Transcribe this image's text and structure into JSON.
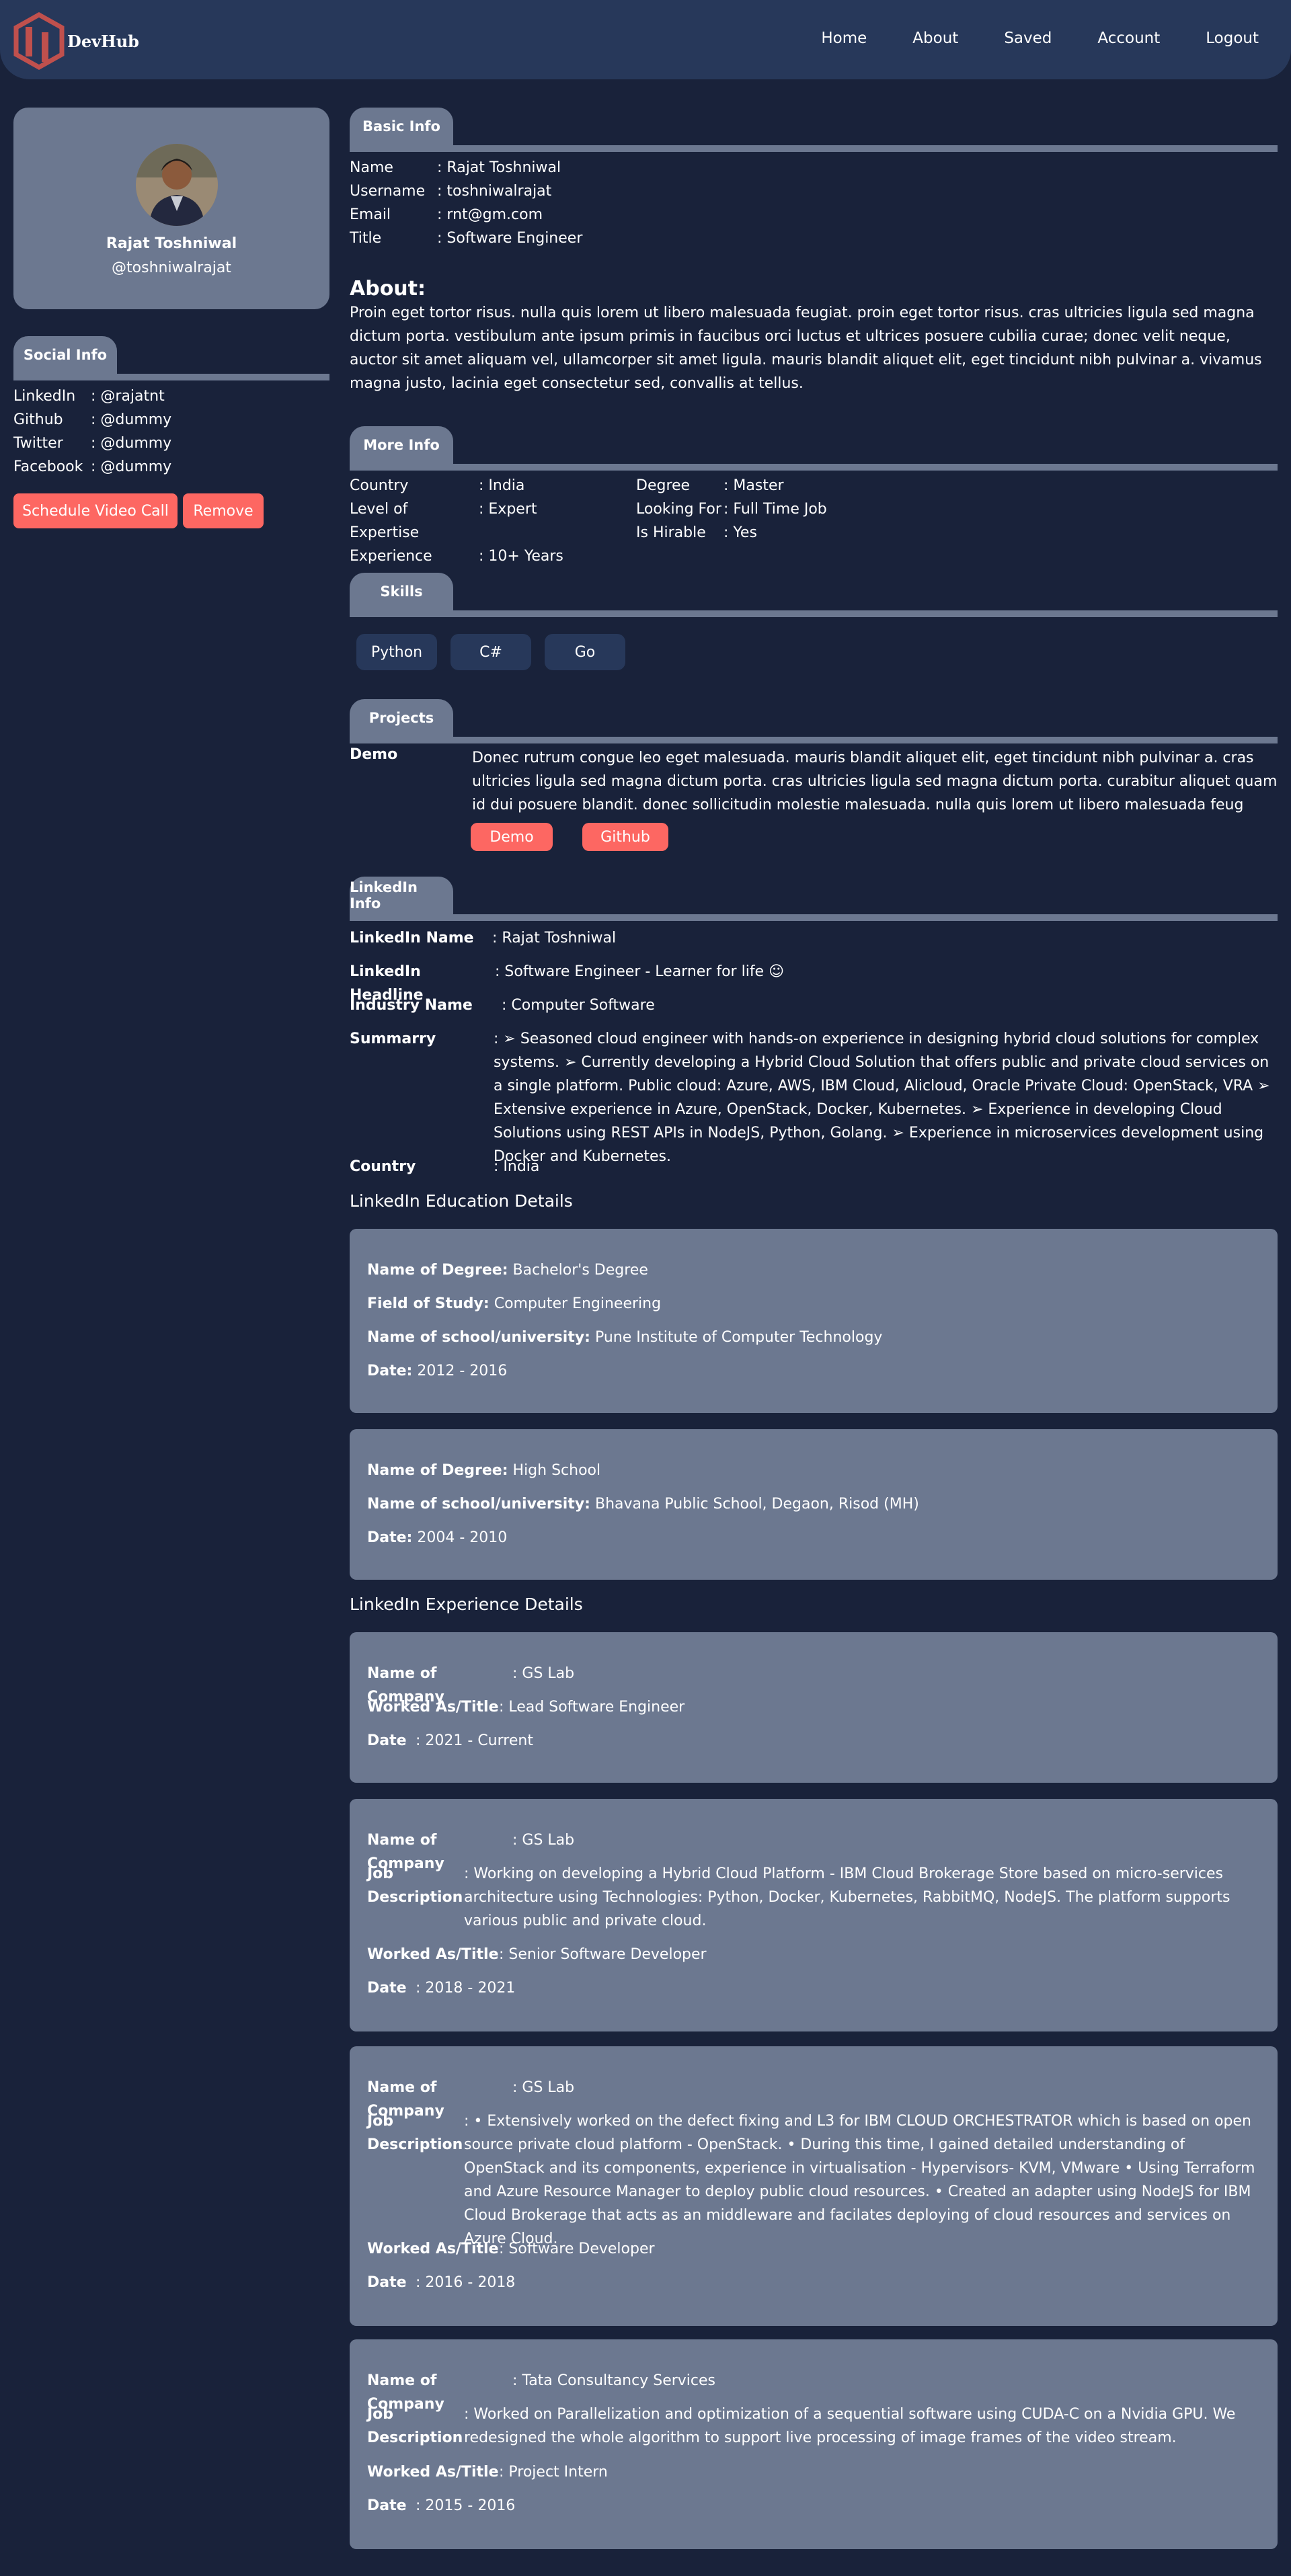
{
  "header": {
    "logo_text": "DevHub",
    "nav": [
      "Home",
      "About",
      "Saved",
      "Account",
      "Logout"
    ]
  },
  "profile": {
    "name": "Rajat Toshniwal",
    "handle": "@toshniwalrajat"
  },
  "social": {
    "tab_label": "Social Info",
    "items": [
      {
        "key": "LinkedIn",
        "value": ": @rajatnt"
      },
      {
        "key": "Github",
        "value": ": @dummy"
      },
      {
        "key": "Twitter",
        "value": ": @dummy"
      },
      {
        "key": "Facebook",
        "value": ": @dummy"
      }
    ],
    "schedule_label": "Schedule Video Call",
    "remove_label": "Remove"
  },
  "basic": {
    "tab_label": "Basic Info",
    "items": [
      {
        "key": "Name",
        "value": ": Rajat Toshniwal"
      },
      {
        "key": "Username",
        "value": ": toshniwalrajat"
      },
      {
        "key": "Email",
        "value": ": rnt@gm.com"
      },
      {
        "key": "Title",
        "value": ": Software Engineer"
      }
    ]
  },
  "about": {
    "title": "About:",
    "text": "Proin eget tortor risus. nulla quis lorem ut libero malesuada feugiat. proin eget tortor risus. cras ultricies ligula sed magna dictum porta. vestibulum ante ipsum primis in faucibus orci luctus et ultrices posuere cubilia curae; donec velit neque, auctor sit amet aliquam vel, ullamcorper sit amet ligula. mauris blandit aliquet elit, eget tincidunt nibh pulvinar a. vivamus magna justo, lacinia eget consectetur sed, convallis at tellus."
  },
  "more": {
    "tab_label": "More Info",
    "left": [
      {
        "key": "Country",
        "value": ": India"
      },
      {
        "key": "Level of Expertise",
        "value": ": Expert"
      },
      {
        "key": "Experience",
        "value": ": 10+ Years"
      }
    ],
    "right": [
      {
        "key": "Degree",
        "value": ": Master"
      },
      {
        "key": "Looking For",
        "value": ": Full Time Job"
      },
      {
        "key": "Is Hirable",
        "value": ": Yes"
      }
    ]
  },
  "skills": {
    "tab_label": "Skills",
    "items": [
      "Python",
      "C#",
      "Go"
    ]
  },
  "projects": {
    "tab_label": "Projects",
    "items": [
      {
        "name": "Demo",
        "description": "Donec rutrum congue leo eget malesuada. mauris blandit aliquet elit, eget tincidunt nibh pulvinar a. cras ultricies ligula sed magna dictum porta. cras ultricies ligula sed magna dictum porta. curabitur aliquet quam id dui posuere blandit. donec sollicitudin molestie malesuada. nulla quis lorem ut libero malesuada feug",
        "demo_label": "Demo",
        "github_label": "Github"
      }
    ]
  },
  "linkedin": {
    "tab_label": "LinkedIn Info",
    "name_key": "LinkedIn Name",
    "name_value": ": Rajat Toshniwal",
    "headline_key": "LinkedIn Headline",
    "headline_value": ": Software Engineer - Learner for life ☺",
    "industry_key": "Industry Name",
    "industry_value": ": Computer Software",
    "summary_key": "Summarry",
    "summary_value": ": ➢ Seasoned cloud engineer with hands-on experience in designing hybrid cloud solutions for complex systems. ➢ Currently developing a Hybrid Cloud Solution that offers public and private cloud services on a single platform. Public cloud: Azure, AWS, IBM Cloud, Alicloud, Oracle Private Cloud: OpenStack, VRA ➢ Extensive experience in Azure, OpenStack, Docker, Kubernetes. ➢ Experience in developing Cloud Solutions using REST APIs in NodeJS, Python, Golang. ➢ Experience in microservices development using Docker and Kubernetes.",
    "country_key": "Country",
    "country_value": ": India"
  },
  "education": {
    "heading": "LinkedIn Education Details",
    "degree_key": "Name of Degree:",
    "field_key": "Field of Study:",
    "school_key": "Name of school/university:",
    "date_key": "Date:",
    "items": [
      {
        "degree": "Bachelor's Degree",
        "field": "Computer Engineering",
        "school": "Pune Institute of Computer Technology",
        "date": "2012 - 2016"
      },
      {
        "degree": "High School",
        "school": "Bhavana Public School, Degaon, Risod (MH)",
        "date": "2004 - 2010"
      }
    ]
  },
  "experience": {
    "heading": "LinkedIn Experience Details",
    "company_key": "Name of Company",
    "job_key": "Job Description",
    "title_key": "Worked As/Title",
    "date_key": "Date",
    "items": [
      {
        "company": ": GS Lab",
        "title": ": Lead Software Engineer",
        "date": ": 2021 - Current"
      },
      {
        "company": ": GS Lab",
        "job": ": Working on developing a Hybrid Cloud Platform - IBM Cloud Brokerage Store based on micro-services architecture using Technologies: Python, Docker, Kubernetes, RabbitMQ, NodeJS. The platform supports various public and private cloud.",
        "title": ": Senior Software Developer",
        "date": ": 2018 - 2021"
      },
      {
        "company": ": GS Lab",
        "job": ": • Extensively worked on the defect fixing and L3 for IBM CLOUD ORCHESTRATOR which is based on open source private cloud platform - OpenStack. • During this time, I gained detailed understanding of OpenStack and its components, experience in virtualisation - Hypervisors- KVM, VMware • Using Terraform and Azure Resource Manager to deploy public cloud resources. • Created an adapter using NodeJS for IBM Cloud Brokerage that acts as an middleware and facilates deploying of cloud resources and services on Azure Cloud.",
        "title": ": Software Developer",
        "date": ": 2016 - 2018"
      },
      {
        "company": ": Tata Consultancy Services",
        "job": ": Worked on Parallelization and optimization of a sequential software using CUDA-C on a Nvidia GPU. We redesigned the whole algorithm to support live processing of image frames of the video stream.",
        "title": ": Project Intern",
        "date": ": 2015 - 2016"
      }
    ]
  },
  "colors": {
    "background": "#19223a",
    "header": "#27385a",
    "card": "#6c7890",
    "accent": "#fd6762",
    "logo": "#c0504d"
  }
}
